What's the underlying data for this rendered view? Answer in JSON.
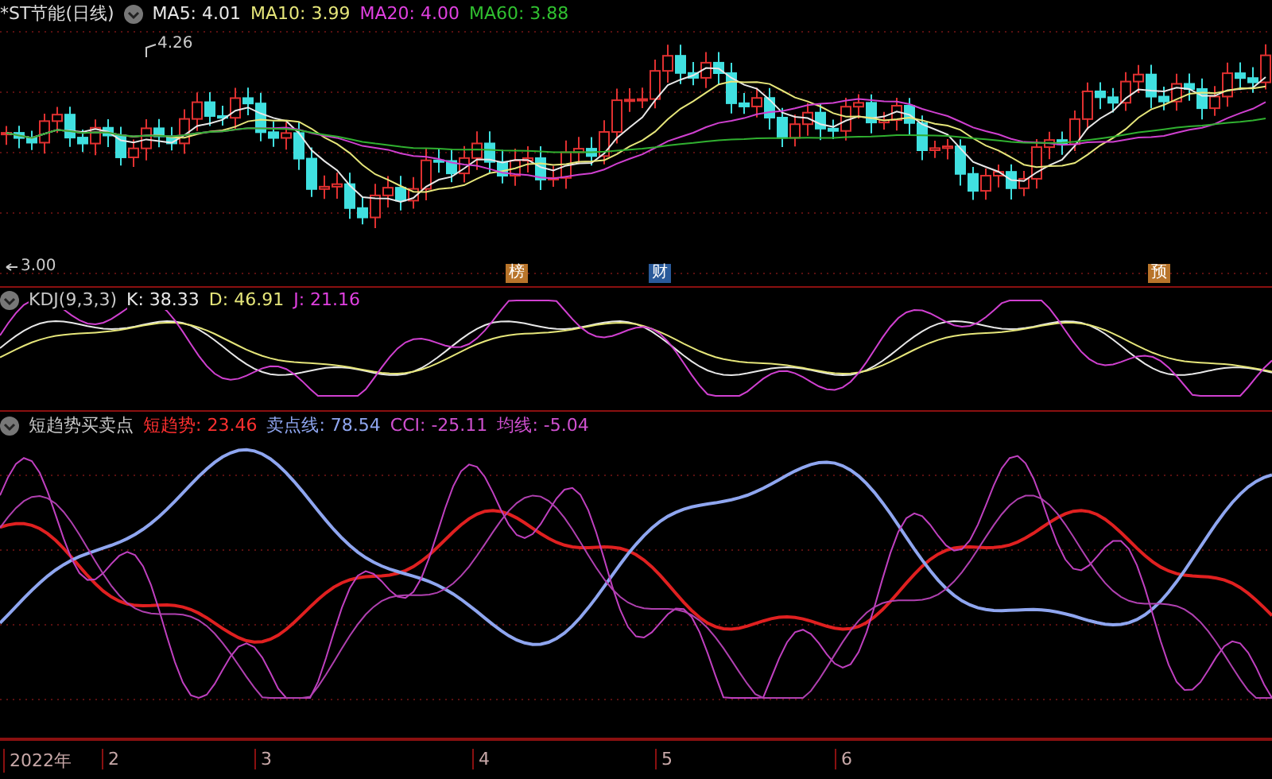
{
  "price_panel": {
    "title": "*ST节能(日线)",
    "legend": [
      {
        "label": "MA5: 4.01",
        "color": "#e8e8e8"
      },
      {
        "label": "MA10: 3.99",
        "color": "#e6e67a"
      },
      {
        "label": "MA20: 4.00",
        "color": "#e040e0"
      },
      {
        "label": "MA60: 3.88",
        "color": "#30c030"
      }
    ],
    "high_label": "4.26",
    "low_label": "3.00",
    "event_tags": [
      {
        "label": "榜",
        "color": "#b8742a"
      },
      {
        "label": "财",
        "color": "#2a5a9a"
      },
      {
        "label": "预",
        "color": "#b8742a"
      }
    ]
  },
  "kdj_panel": {
    "legend": [
      {
        "label": "KDJ(9,3,3)",
        "color": "#c8c8c8"
      },
      {
        "label": "K: 38.33",
        "color": "#e8e8e8"
      },
      {
        "label": "D: 46.91",
        "color": "#e6e67a"
      },
      {
        "label": "J: 21.16",
        "color": "#e040e0"
      }
    ]
  },
  "trend_panel": {
    "legend": [
      {
        "label": "短趋势买卖点",
        "color": "#c8c8c8"
      },
      {
        "label": "短趋势: 23.46",
        "color": "#ff3030"
      },
      {
        "label": "卖点线: 78.54",
        "color": "#8fa6f0"
      },
      {
        "label": "CCI: -25.11",
        "color": "#d050d0"
      },
      {
        "label": "均线: -5.04",
        "color": "#d050d0"
      }
    ]
  },
  "time_axis": [
    "2022年",
    "2",
    "3",
    "4",
    "5",
    "6"
  ]
}
